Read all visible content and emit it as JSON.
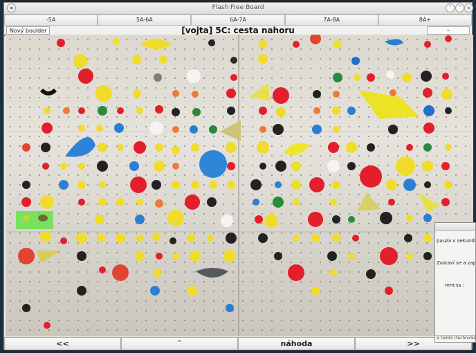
{
  "window": {
    "title": "Flash Free Board"
  },
  "grades": [
    "-5A",
    "5A-6A",
    "6A-7A",
    "7A-8A",
    "8A+"
  ],
  "route": {
    "new_boulder_label": "Nový boulder",
    "title": "[vojta] 5C: cesta nahoru",
    "minus_label": "–"
  },
  "bottom_nav": {
    "prev_label": "<<",
    "middle_label": "ˇ",
    "random_label": "náhoda",
    "next_label": ">>"
  },
  "timer_dialog": {
    "line1": "pauza v sekundá",
    "line2": "Zastaví se a zap",
    "field_label": "mm:ss :",
    "footer": "V tomto (technické"
  },
  "colors": {
    "highlight": "#67e34a",
    "accent_border": "#c74a37"
  }
}
